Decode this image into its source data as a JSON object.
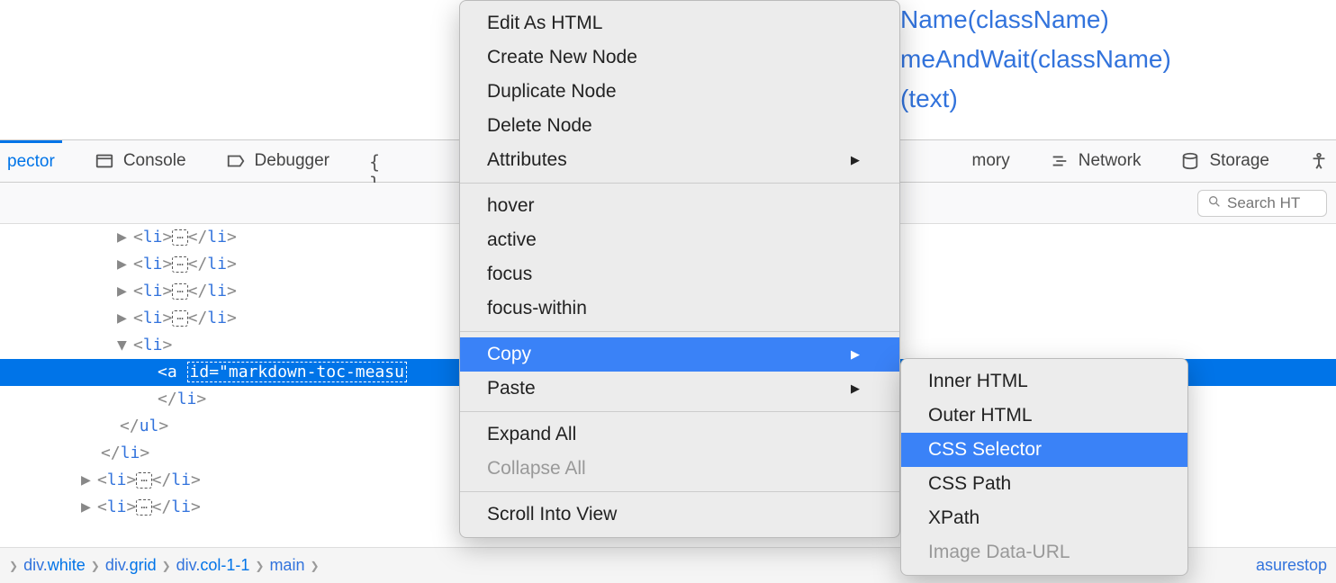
{
  "page_links": [
    "Name(className)",
    "meAndWait(className)",
    "(text)"
  ],
  "toolbar": {
    "inspector": "pector",
    "console": "Console",
    "debugger": "Debugger",
    "style": "",
    "memory": "mory",
    "network": "Network",
    "storage": "Storage"
  },
  "search": {
    "placeholder": "Search HT"
  },
  "tree": {
    "collapsed_li": "li",
    "ellipsis": "⋯",
    "open_li": "li",
    "selected_a_open": "a",
    "selected_attr": "id=\"markdown-toc-measu",
    "close_li": "li",
    "close_ul": "ul"
  },
  "crumbs": {
    "items": [
      {
        "tag": "div",
        "cls": "white"
      },
      {
        "tag": "div",
        "cls": "grid"
      },
      {
        "tag": "div",
        "cls": "col-1-1"
      },
      {
        "tag": "main",
        "cls": ""
      }
    ],
    "right": "asurestop"
  },
  "context_menu": {
    "group1": [
      "Edit As HTML",
      "Create New Node",
      "Duplicate Node",
      "Delete Node"
    ],
    "attributes": "Attributes",
    "pseudo": [
      "hover",
      "active",
      "focus",
      "focus-within"
    ],
    "copy": "Copy",
    "paste": "Paste",
    "expand": "Expand All",
    "collapse": "Collapse All",
    "scroll": "Scroll Into View"
  },
  "copy_submenu": {
    "items": [
      "Inner HTML",
      "Outer HTML",
      "CSS Selector",
      "CSS Path",
      "XPath"
    ],
    "disabled": "Image Data-URL",
    "selected_index": 2
  }
}
